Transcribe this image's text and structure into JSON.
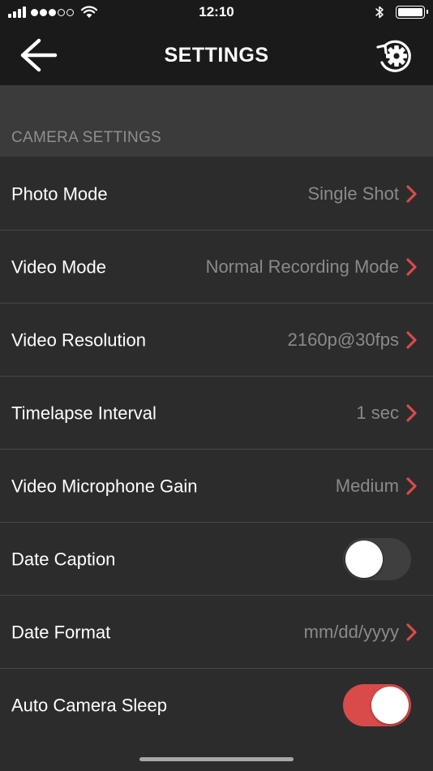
{
  "status_bar": {
    "time": "12:10",
    "signal_bars": 4,
    "carrier_dots_filled": 3,
    "carrier_dots_total": 5,
    "battery_level": 1.0
  },
  "nav": {
    "title": "SETTINGS",
    "back_icon": "arrow-left-icon",
    "reset_icon": "reset-gear-icon"
  },
  "section": {
    "title": "CAMERA SETTINGS"
  },
  "rows": [
    {
      "label": "Photo Mode",
      "value": "Single Shot",
      "type": "select"
    },
    {
      "label": "Video Mode",
      "value": "Normal Recording Mode",
      "type": "select"
    },
    {
      "label": "Video Resolution",
      "value": "2160p@30fps",
      "type": "select"
    },
    {
      "label": "Timelapse Interval",
      "value": "1 sec",
      "type": "select"
    },
    {
      "label": "Video Microphone Gain",
      "value": "Medium",
      "type": "select"
    },
    {
      "label": "Date Caption",
      "type": "toggle",
      "on": false
    },
    {
      "label": "Date Format",
      "value": "mm/dd/yyyy",
      "type": "select"
    },
    {
      "label": "Auto Camera Sleep",
      "type": "toggle",
      "on": true
    }
  ],
  "colors": {
    "accent": "#d94a4a",
    "background": "#2c2c2c",
    "header": "#1a1a1a",
    "section_header": "#3b3b3b"
  }
}
